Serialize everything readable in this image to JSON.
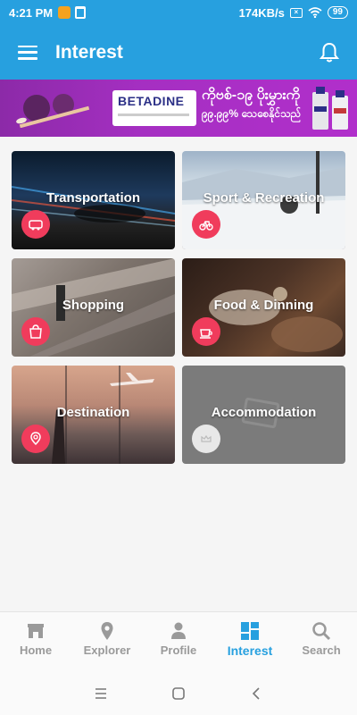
{
  "status": {
    "time": "4:21 PM",
    "speed": "174KB/s",
    "battery": "99"
  },
  "appbar": {
    "title": "Interest"
  },
  "banner": {
    "brand": "BETADINE",
    "promo_line1": "ကိုဗစ်-၁၉ ပိုးမွှားကို",
    "promo_line2": "၉၉.၉၉% သေစေနိုင်သည်"
  },
  "categories": [
    {
      "label": "Transportation",
      "icon": "bus-icon"
    },
    {
      "label": "Sport & Recreation",
      "icon": "bicycle-icon"
    },
    {
      "label": "Shopping",
      "icon": "shopping-bag-icon"
    },
    {
      "label": "Food & Dinning",
      "icon": "coffee-cup-icon"
    },
    {
      "label": "Destination",
      "icon": "location-pin-icon"
    },
    {
      "label": "Accommodation",
      "icon": "crown-icon"
    }
  ],
  "bottom_nav": [
    {
      "label": "Home",
      "icon": "home-icon"
    },
    {
      "label": "Explorer",
      "icon": "map-pin-icon"
    },
    {
      "label": "Profile",
      "icon": "person-icon"
    },
    {
      "label": "Interest",
      "icon": "grid-icon",
      "active": true
    },
    {
      "label": "Search",
      "icon": "search-icon"
    }
  ],
  "colors": {
    "primary": "#27a0df",
    "badge": "#f03c5c"
  }
}
